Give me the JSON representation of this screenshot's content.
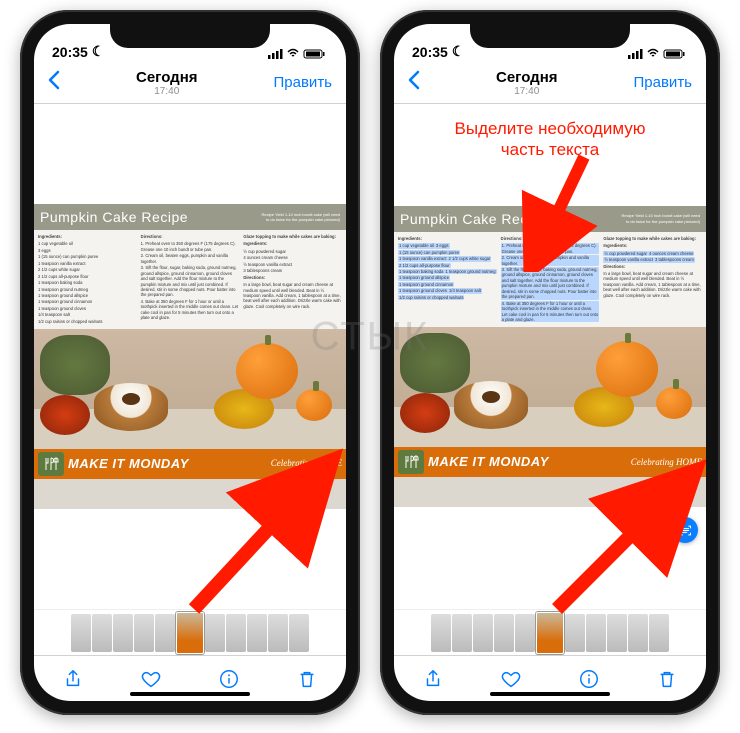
{
  "watermark": "СТЫК",
  "statusbar": {
    "time": "20:35"
  },
  "navbar": {
    "title": "Сегодня",
    "subtitle": "17:40",
    "edit_label": "Править"
  },
  "recipe": {
    "title": "Pumpkin Cake Recipe",
    "yield": "Recipe Yield 1-10 inch bundt cake (will need to do twice for the pumpkin cake pictured)",
    "ingredients_h": "Ingredients:",
    "ingredients": [
      "1 cup vegetable oil",
      "3 eggs",
      "1 (15 ounce) can pumpkin puree",
      "1 teaspoon vanilla extract",
      "2 1/2 cups white sugar",
      "2 1/2 cups all-purpose flour",
      "1 teaspoon baking soda",
      "1 teaspoon ground nutmeg",
      "1 teaspoon ground allspice",
      "1 teaspoon ground cinnamon",
      "1 teaspoon ground cloves",
      "1/4 teaspoon salt",
      "1/2 cup raisins or chopped walnuts"
    ],
    "directions_h": "Directions:",
    "directions": [
      "1. Preheat oven to 350 degrees F (175 degrees C). Grease one 10 inch bundt or tube pan.",
      "2. Cream oil, beaten eggs, pumpkin and vanilla together.",
      "3. Sift the flour, sugar, baking soda, ground nutmeg, ground allspice, ground cinnamon, ground cloves and salt together. Add the flour mixture to the pumpkin mixture and mix until just combined. If desired, stir in some chopped nuts. Pour batter into the prepared pan.",
      "4. Bake at 350 degrees F for 1 hour or until a toothpick inserted in the middle comes out clean. Let cake cool in pan for 5 minutes then turn out onto a plate and glaze."
    ],
    "glaze_h": "Glaze topping to make while cakes are baking:",
    "glaze_ing_h": "Ingredients:",
    "glaze_ingredients": [
      "½ cup powdered sugar",
      "4 ounces cream cheese",
      "½ teaspoon vanilla extract",
      "3 tablespoons cream"
    ],
    "glaze_dir_h": "Directions:",
    "glaze_directions": "In a large bowl, beat sugar and cream cheese at medium speed until well blended. Beat in ½ teaspoon vanilla. Add cream, 1 tablespoon at a time, beat well after each addition. Drizzle warm cake with glaze. Cool completely on wire rack."
  },
  "banner": {
    "text": "MAKE IT MONDAY",
    "home": "Celebrating HOME"
  },
  "annotation": {
    "text_line1": "Выделите необходимую",
    "text_line2": "часть текста"
  }
}
